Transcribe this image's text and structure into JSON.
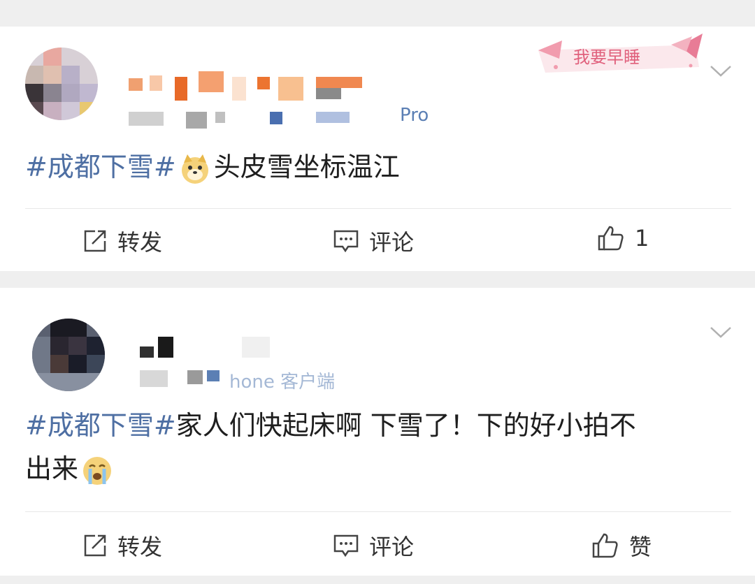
{
  "posts": [
    {
      "device_suffix": "Pro",
      "hashtag": "#成都下雪#",
      "text": "头皮雪坐标温江",
      "sticker_text": "我要早睡",
      "actions": {
        "repost": "转发",
        "comment": "评论",
        "like": "1"
      }
    },
    {
      "device_suffix": "hone 客户端",
      "hashtag": "#成都下雪#",
      "text_line1": "家人们快起床啊 下雪了！下的好小拍不",
      "text_line2": "出来",
      "actions": {
        "repost": "转发",
        "comment": "评论",
        "like": "赞"
      }
    }
  ],
  "icons": {
    "repost": "repost-icon",
    "comment": "comment-icon",
    "like": "thumbs-up-icon",
    "menu": "chevron-down-icon",
    "emoji1": "doge-emoji-icon",
    "emoji2": "crying-emoji-icon"
  },
  "colors": {
    "hashtag": "#4e6fa3",
    "meta": "#5b7fb4",
    "background": "#f0f0f0"
  }
}
